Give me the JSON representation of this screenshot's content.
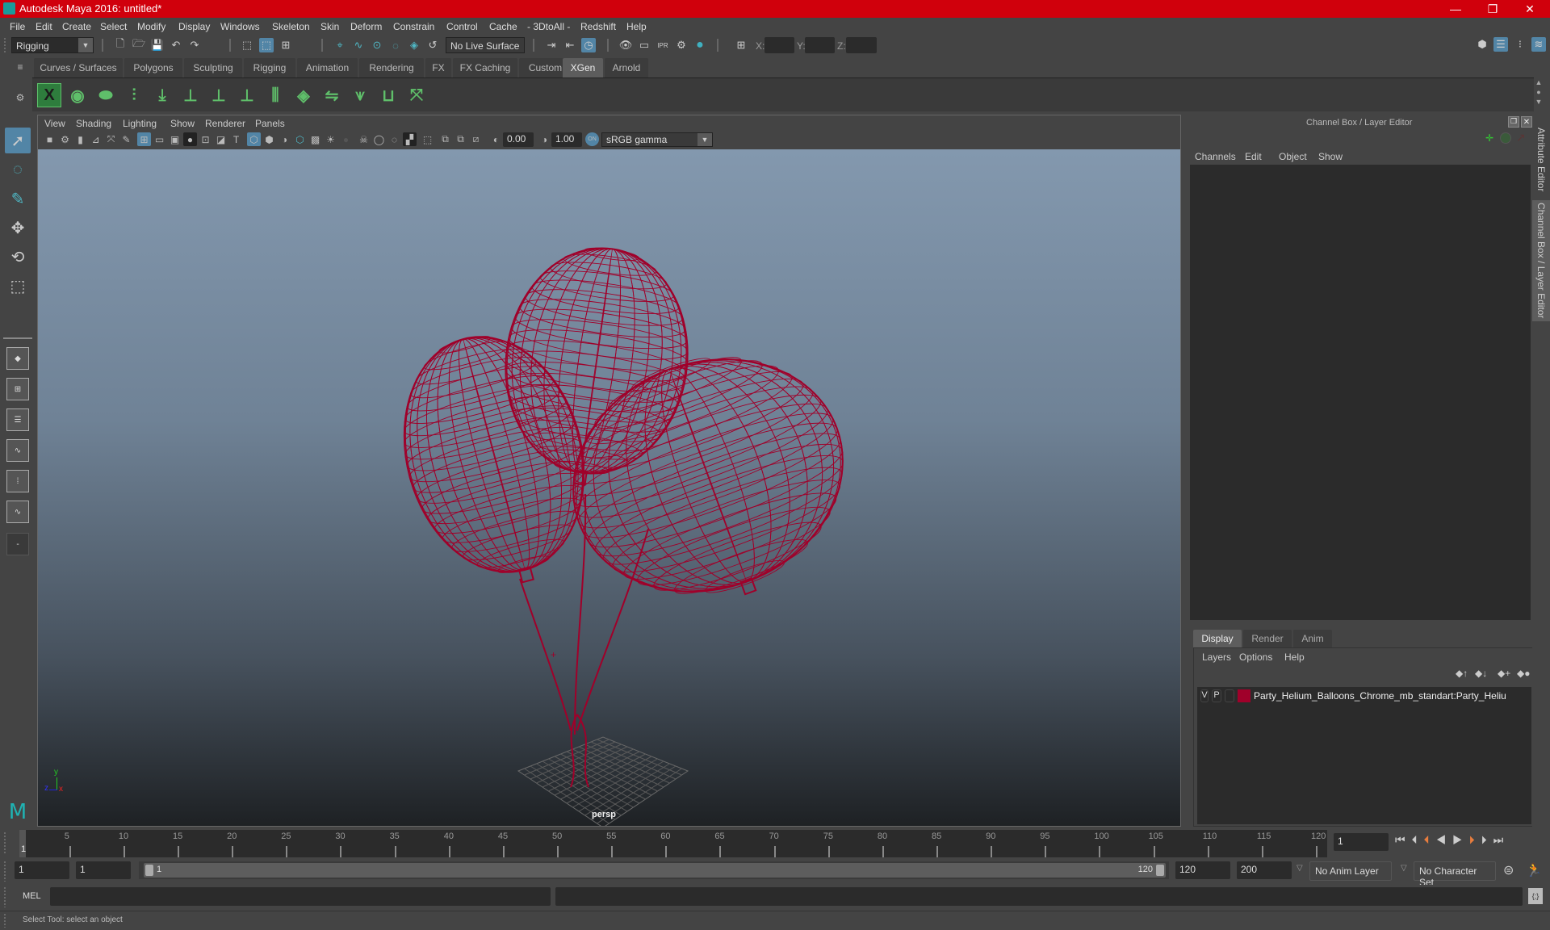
{
  "window": {
    "title": "Autodesk Maya 2016: untitled*",
    "controls": {
      "minimize": "—",
      "restore": "❐",
      "close": "✕"
    }
  },
  "menubar": [
    "File",
    "Edit",
    "Create",
    "Select",
    "Modify",
    "Display",
    "Windows",
    "Skeleton",
    "Skin",
    "Deform",
    "Constrain",
    "Control",
    "Cache",
    "- 3DtoAll -",
    "Redshift",
    "Help"
  ],
  "statusline": {
    "menuset": "Rigging",
    "live_surface": "No Live Surface",
    "coord_labels": {
      "x": "X:",
      "y": "Y:",
      "z": "Z:"
    },
    "coord_values": {
      "x": "",
      "y": "",
      "z": ""
    }
  },
  "shelf": {
    "tabs": [
      "Curves / Surfaces",
      "Polygons",
      "Sculpting",
      "Rigging",
      "Animation",
      "Rendering",
      "FX",
      "FX Caching",
      "Custom",
      "XGen",
      "Arnold"
    ],
    "active_tab": "XGen",
    "icons": [
      "xgen-editor-icon",
      "xgen-preview-icon",
      "xgen-clear-preview-icon",
      "xgen-add-guides-icon",
      "xgen-place-guides-icon",
      "xgen-add-guide-icon",
      "xgen-guide-visibility-icon",
      "xgen-lock-guide-icon",
      "xgen-sculpt-guides-icon",
      "xgen-select-guides-icon",
      "xgen-flip-guides-icon",
      "xgen-select-cvs-icon",
      "xgen-tube-guides-icon",
      "xgen-delete-guides-icon"
    ]
  },
  "viewport": {
    "menu": [
      "View",
      "Shading",
      "Lighting",
      "Show",
      "Renderer",
      "Panels"
    ],
    "exposure": "0.00",
    "gamma": "1.00",
    "color_space": "sRGB gamma",
    "camera_label": "persp",
    "axis": {
      "x": "x",
      "y": "y",
      "z": "z"
    },
    "wire_color": "#a0002a"
  },
  "channel_box": {
    "title": "Channel Box / Layer Editor",
    "menu": [
      "Channels",
      "Edit",
      "Object",
      "Show"
    ]
  },
  "layer_editor": {
    "tabs": [
      "Display",
      "Render",
      "Anim"
    ],
    "active_tab": "Display",
    "menu": [
      "Layers",
      "Options",
      "Help"
    ],
    "layers": [
      {
        "v": "V",
        "p": "P",
        "color": "#a0002a",
        "name": "Party_Helium_Balloons_Chrome_mb_standart:Party_Heliu"
      }
    ]
  },
  "side_tabs": [
    "Attribute Editor",
    "Channel Box / Layer Editor"
  ],
  "timeline": {
    "ticks": [
      5,
      10,
      15,
      20,
      25,
      30,
      35,
      40,
      45,
      50,
      55,
      60,
      65,
      70,
      75,
      80,
      85,
      90,
      95,
      100,
      105,
      110,
      115,
      120
    ],
    "current_frame_marker": "1",
    "current_frame": "1"
  },
  "range": {
    "start": "1",
    "playback_start": "1",
    "slider_start": "1",
    "slider_end": "120",
    "playback_end": "120",
    "end": "200",
    "anim_layer": "No Anim Layer",
    "character_set": "No Character Set"
  },
  "command": {
    "language": "MEL",
    "input": "",
    "result": ""
  },
  "help_line": "Select Tool: select an object"
}
